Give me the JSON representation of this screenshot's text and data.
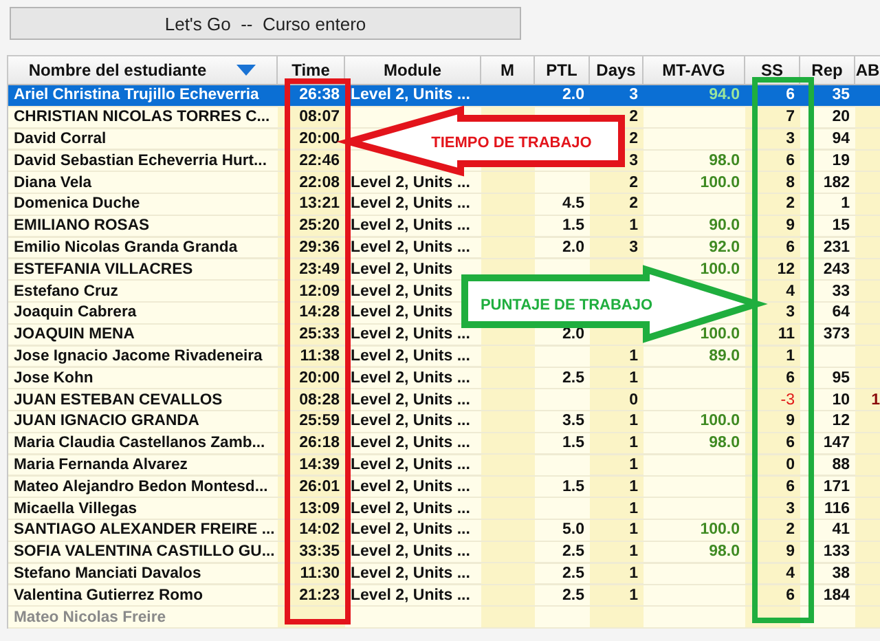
{
  "window": {
    "title": "Let's Go  --  Curso entero"
  },
  "table": {
    "columns": [
      {
        "label": "Nombre del estudiante",
        "sorted": true
      },
      {
        "label": "Time",
        "sorted": false
      },
      {
        "label": "Module",
        "sorted": false
      },
      {
        "label": "M",
        "sorted": false
      },
      {
        "label": "PTL",
        "sorted": false
      },
      {
        "label": "Days",
        "sorted": false
      },
      {
        "label": "MT-AVG",
        "sorted": false
      },
      {
        "label": "SS",
        "sorted": false
      },
      {
        "label": "Rep",
        "sorted": false
      },
      {
        "label": "AB",
        "sorted": false
      }
    ],
    "rows": [
      {
        "name": "Ariel Christina Trujillo Echeverria",
        "time": "26:38",
        "module": "Level 2, Units ...",
        "ptl": "2.0",
        "days": "3",
        "mt_avg": "94.0",
        "ss": "6",
        "rep": "35",
        "selected": true,
        "inactive": false,
        "ss_negative": false
      },
      {
        "name": "CHRISTIAN NICOLAS TORRES C...",
        "time": "08:07",
        "days": "2",
        "ss": "7",
        "rep": "20",
        "selected": false,
        "inactive": false,
        "ss_negative": false
      },
      {
        "name": "David Corral",
        "time": "20:00",
        "days": "2",
        "ss": "3",
        "rep": "94",
        "selected": false,
        "inactive": false,
        "ss_negative": false
      },
      {
        "name": "David Sebastian Echeverria Hurt...",
        "time": "22:46",
        "days": "3",
        "mt_avg": "98.0",
        "ss": "6",
        "rep": "19",
        "selected": false,
        "inactive": false,
        "ss_negative": false
      },
      {
        "name": "Diana Vela",
        "time": "22:08",
        "module": "Level 2, Units ...",
        "days": "2",
        "mt_avg": "100.0",
        "ss": "8",
        "rep": "182",
        "selected": false,
        "inactive": false,
        "ss_negative": false
      },
      {
        "name": "Domenica Duche",
        "time": "13:21",
        "module": "Level 2, Units ...",
        "ptl": "4.5",
        "days": "2",
        "ss": "2",
        "rep": "1",
        "selected": false,
        "inactive": false,
        "ss_negative": false
      },
      {
        "name": "EMILIANO ROSAS",
        "time": "25:20",
        "module": "Level 2, Units ...",
        "ptl": "1.5",
        "days": "1",
        "mt_avg": "90.0",
        "ss": "9",
        "rep": "15",
        "selected": false,
        "inactive": false,
        "ss_negative": false
      },
      {
        "name": "Emilio Nicolas Granda Granda",
        "time": "29:36",
        "module": "Level 2, Units ...",
        "ptl": "2.0",
        "days": "3",
        "mt_avg": "92.0",
        "ss": "6",
        "rep": "231",
        "selected": false,
        "inactive": false,
        "ss_negative": false
      },
      {
        "name": "ESTEFANIA VILLACRES",
        "time": "23:49",
        "module": "Level 2, Units",
        "mt_avg": "100.0",
        "ss": "12",
        "rep": "243",
        "selected": false,
        "inactive": false,
        "ss_negative": false
      },
      {
        "name": "Estefano Cruz",
        "time": "12:09",
        "module": "Level 2, Units",
        "ss": "4",
        "rep": "33",
        "selected": false,
        "inactive": false,
        "ss_negative": false
      },
      {
        "name": "Joaquin Cabrera",
        "time": "14:28",
        "module": "Level 2, Units",
        "ss": "3",
        "rep": "64",
        "selected": false,
        "inactive": false,
        "ss_negative": false
      },
      {
        "name": "JOAQUIN MENA",
        "time": "25:33",
        "module": "Level 2, Units ...",
        "ptl": "2.0",
        "mt_avg": "100.0",
        "ss": "11",
        "rep": "373",
        "selected": false,
        "inactive": false,
        "ss_negative": false
      },
      {
        "name": "Jose Ignacio Jacome Rivadeneira",
        "time": "11:38",
        "module": "Level 2, Units ...",
        "days": "1",
        "mt_avg": "89.0",
        "ss": "1",
        "selected": false,
        "inactive": false,
        "ss_negative": false
      },
      {
        "name": "Jose Kohn",
        "time": "20:00",
        "module": "Level 2, Units ...",
        "ptl": "2.5",
        "days": "1",
        "ss": "6",
        "rep": "95",
        "selected": false,
        "inactive": false,
        "ss_negative": false
      },
      {
        "name": "JUAN ESTEBAN CEVALLOS",
        "time": "08:28",
        "module": "Level 2, Units ...",
        "days": "0",
        "ss": "-3",
        "rep": "10",
        "ab": "1",
        "selected": false,
        "inactive": false,
        "ss_negative": true
      },
      {
        "name": "JUAN IGNACIO GRANDA",
        "time": "25:59",
        "module": "Level 2, Units ...",
        "ptl": "3.5",
        "days": "1",
        "mt_avg": "100.0",
        "ss": "9",
        "rep": "12",
        "selected": false,
        "inactive": false,
        "ss_negative": false
      },
      {
        "name": "Maria Claudia Castellanos Zamb...",
        "time": "26:18",
        "module": "Level 2, Units ...",
        "ptl": "1.5",
        "days": "1",
        "mt_avg": "98.0",
        "ss": "6",
        "rep": "147",
        "selected": false,
        "inactive": false,
        "ss_negative": false
      },
      {
        "name": "Maria Fernanda Alvarez",
        "time": "14:39",
        "module": "Level 2, Units ...",
        "days": "1",
        "ss": "0",
        "rep": "88",
        "selected": false,
        "inactive": false,
        "ss_negative": false
      },
      {
        "name": "Mateo Alejandro Bedon Montesd...",
        "time": "26:01",
        "module": "Level 2, Units ...",
        "ptl": "1.5",
        "days": "1",
        "ss": "6",
        "rep": "171",
        "selected": false,
        "inactive": false,
        "ss_negative": false
      },
      {
        "name": "Micaella Villegas",
        "time": "13:09",
        "module": "Level 2, Units ...",
        "days": "1",
        "ss": "3",
        "rep": "116",
        "selected": false,
        "inactive": false,
        "ss_negative": false
      },
      {
        "name": "SANTIAGO ALEXANDER FREIRE ...",
        "time": "14:02",
        "module": "Level 2, Units ...",
        "ptl": "5.0",
        "days": "1",
        "mt_avg": "100.0",
        "ss": "2",
        "rep": "41",
        "selected": false,
        "inactive": false,
        "ss_negative": false
      },
      {
        "name": "SOFIA VALENTINA CASTILLO GU...",
        "time": "33:35",
        "module": "Level 2, Units ...",
        "ptl": "2.5",
        "days": "1",
        "mt_avg": "98.0",
        "ss": "9",
        "rep": "133",
        "selected": false,
        "inactive": false,
        "ss_negative": false
      },
      {
        "name": "Stefano  Manciati Davalos",
        "time": "11:30",
        "module": "Level 2, Units ...",
        "ptl": "2.5",
        "days": "1",
        "ss": "4",
        "rep": "38",
        "selected": false,
        "inactive": false,
        "ss_negative": false
      },
      {
        "name": "Valentina Gutierrez Romo",
        "time": "21:23",
        "module": "Level 2, Units ...",
        "ptl": "2.5",
        "days": "1",
        "ss": "6",
        "rep": "184",
        "selected": false,
        "inactive": false,
        "ss_negative": false
      },
      {
        "name": "Mateo Nicolas Freire",
        "selected": false,
        "inactive": true,
        "ss_negative": false
      }
    ]
  },
  "annotations": [
    {
      "kind": "frame",
      "color": "#e3141b"
    },
    {
      "kind": "arrow",
      "label": "TIEMPO DE TRABAJO",
      "color": "#e3141b"
    },
    {
      "kind": "frame",
      "color": "#1fae3e"
    },
    {
      "kind": "arrow",
      "label": "PUNTAJE DE TRABAJO",
      "color": "#1fae3e"
    }
  ]
}
